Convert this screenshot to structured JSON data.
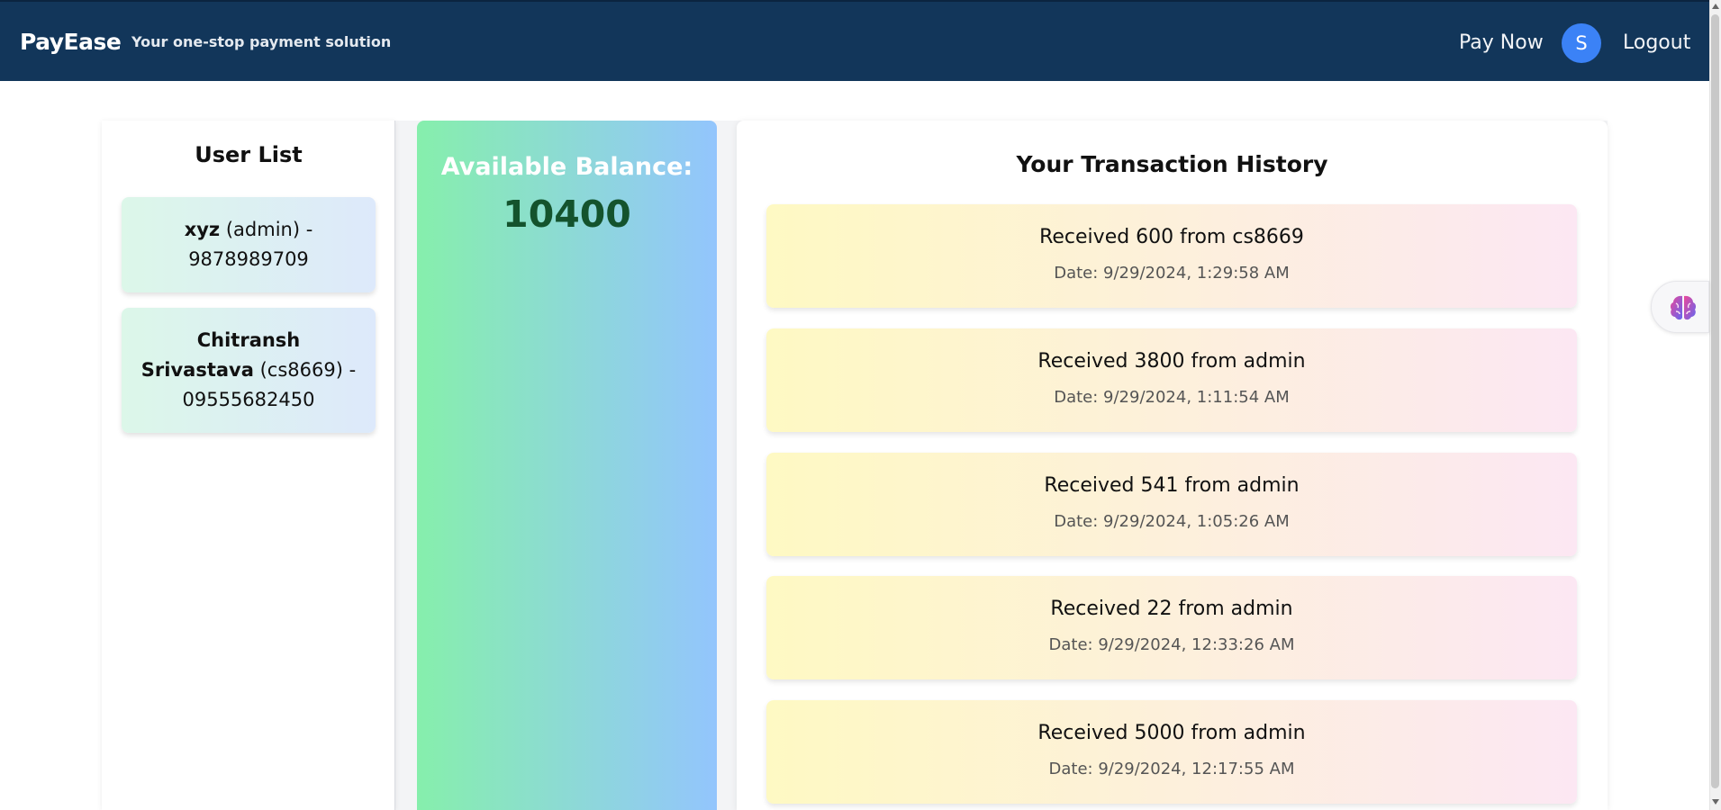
{
  "header": {
    "brand": "PayEase",
    "tagline": "Your one-stop payment solution",
    "pay_now": "Pay Now",
    "avatar_initial": "S",
    "logout": "Logout"
  },
  "user_list": {
    "title": "User List",
    "users": [
      {
        "name": "xyz",
        "username": "(admin)",
        "phone": "- 9878989709"
      },
      {
        "name": "Chitransh Srivastava",
        "username": "(cs8669)",
        "phone": "- 09555682450"
      }
    ]
  },
  "balance": {
    "label": "Available Balance:",
    "value": "10400"
  },
  "transactions": {
    "title": "Your Transaction History",
    "items": [
      {
        "text": "Received 600 from cs8669",
        "date": "Date: 9/29/2024, 1:29:58 AM"
      },
      {
        "text": "Received 3800 from admin",
        "date": "Date: 9/29/2024, 1:11:54 AM"
      },
      {
        "text": "Received 541 from admin",
        "date": "Date: 9/29/2024, 1:05:26 AM"
      },
      {
        "text": "Received 22 from admin",
        "date": "Date: 9/29/2024, 12:33:26 AM"
      },
      {
        "text": "Received 5000 from admin",
        "date": "Date: 9/29/2024, 12:17:55 AM"
      }
    ]
  },
  "colors": {
    "navbar": "#12365a",
    "avatar": "#3b82f6",
    "balance_value": "#14532d",
    "balance_gradient": [
      "#86efac",
      "#93c5fd"
    ],
    "user_card_gradient": [
      "#dcf7e9",
      "#dde9fb"
    ],
    "txn_card_gradient": [
      "#fef9c3",
      "#fce7f3"
    ]
  },
  "icons": {
    "floating_widget": "brain-icon"
  }
}
